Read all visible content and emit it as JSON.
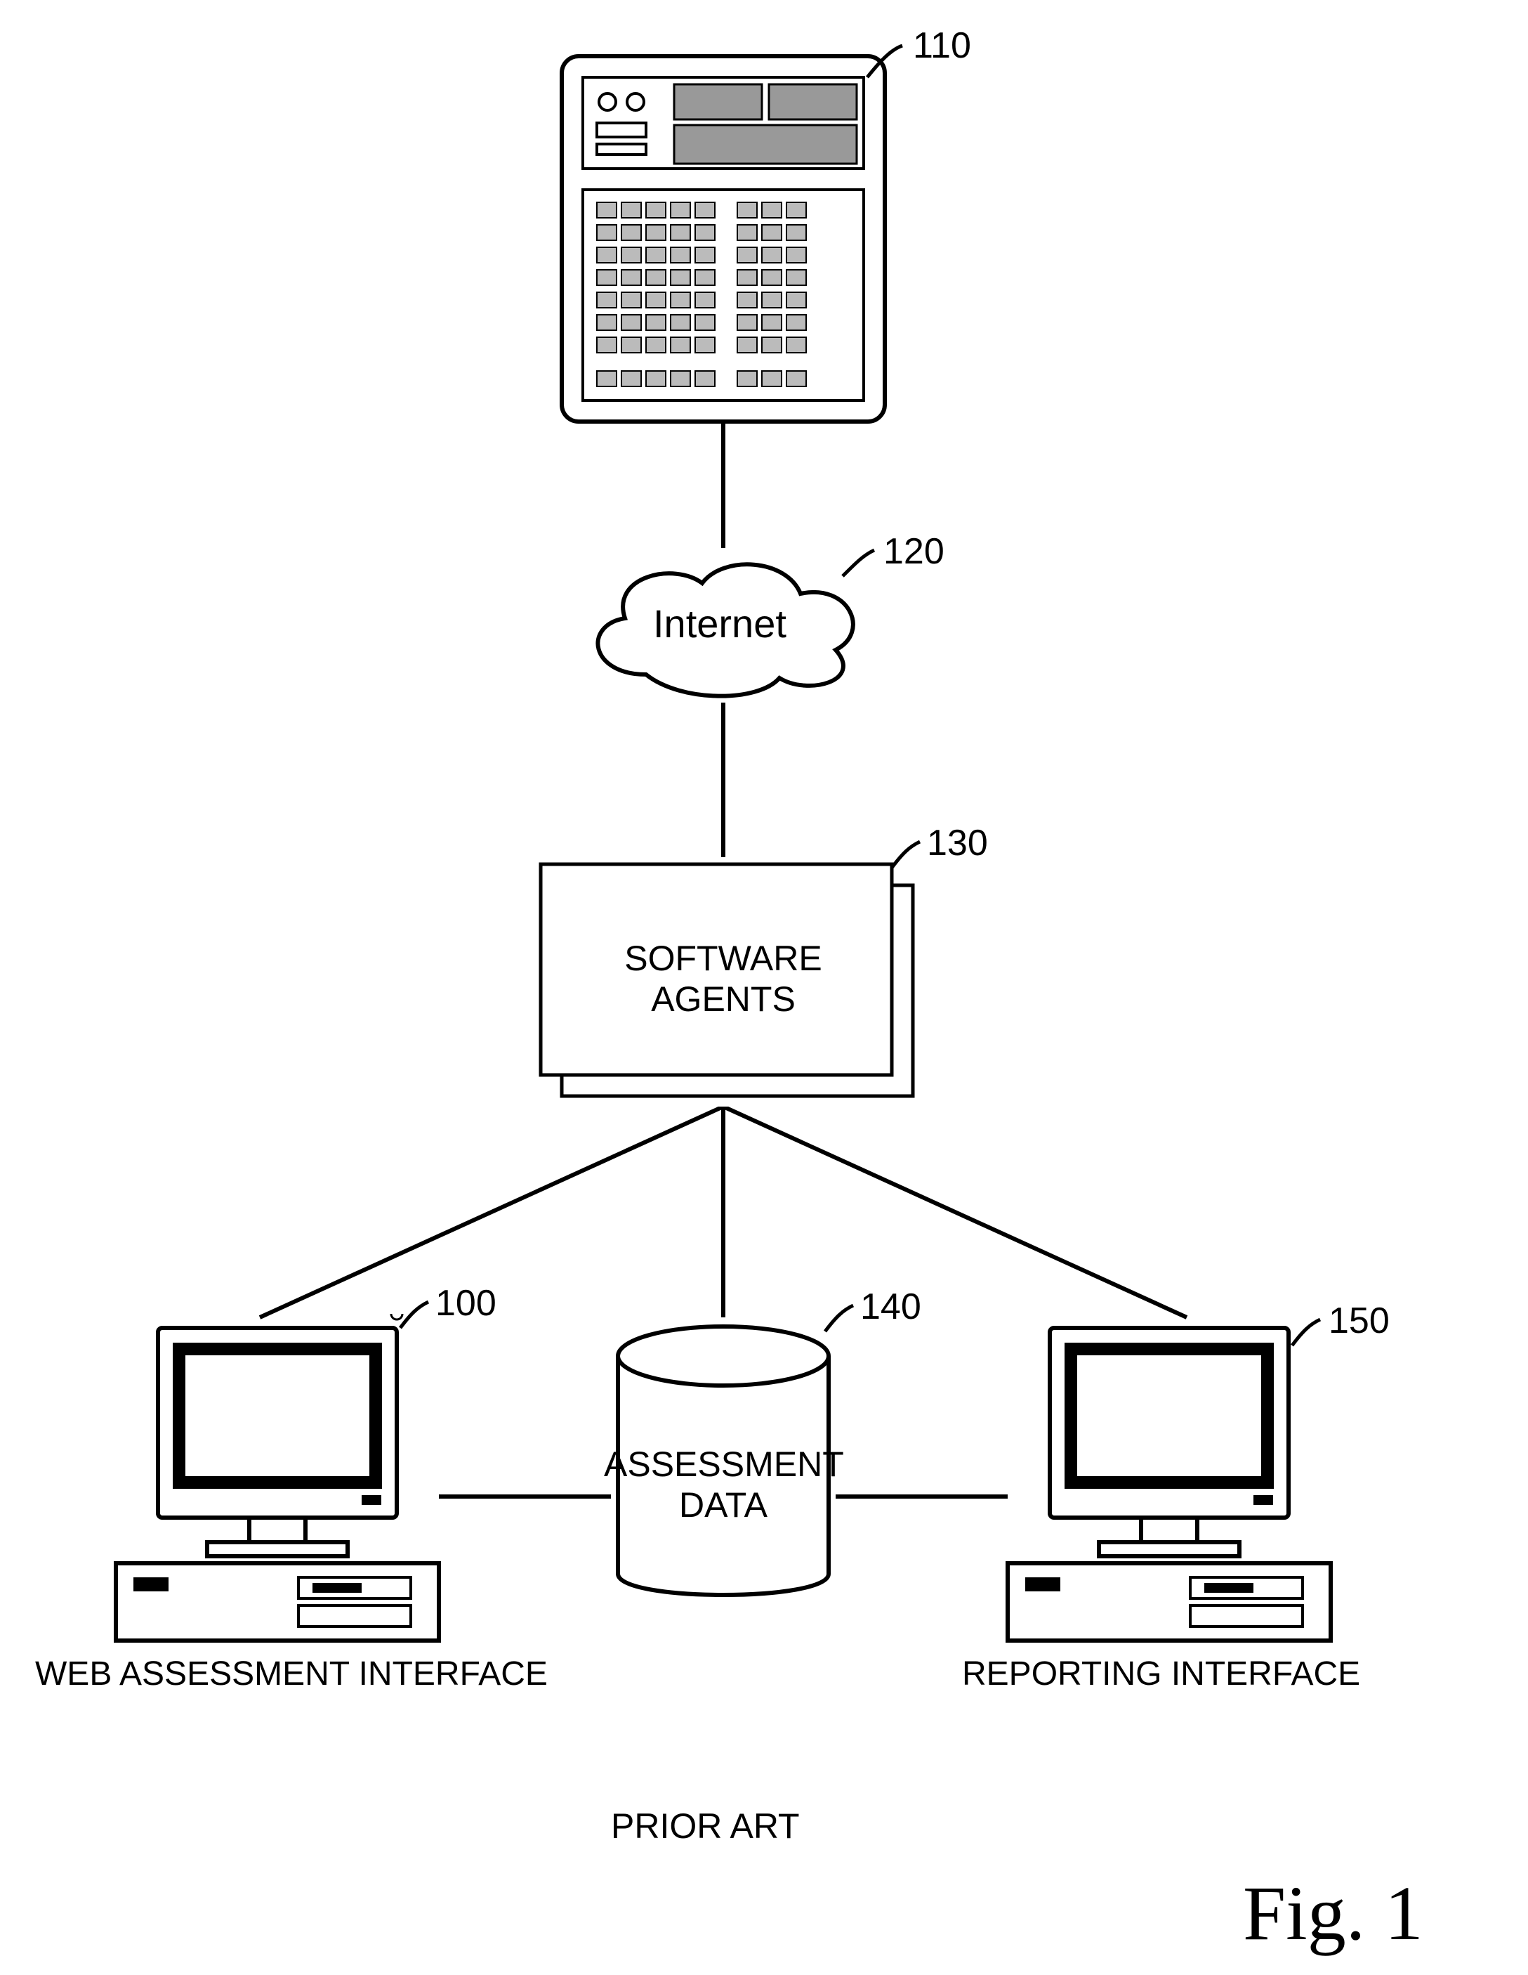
{
  "nodes": {
    "server": {
      "ref": "110"
    },
    "cloud": {
      "ref": "120",
      "label": "Internet"
    },
    "agents": {
      "ref": "130",
      "label1": "SOFTWARE",
      "label2": "AGENTS"
    },
    "db": {
      "ref": "140",
      "label1": "ASSESSMENT",
      "label2": "DATA"
    },
    "pc_left": {
      "ref": "100",
      "caption": "WEB ASSESSMENT INTERFACE"
    },
    "pc_right": {
      "ref": "150",
      "caption": "REPORTING INTERFACE"
    }
  },
  "footer": {
    "prior_art": "PRIOR ART",
    "figure": "Fig. 1"
  }
}
